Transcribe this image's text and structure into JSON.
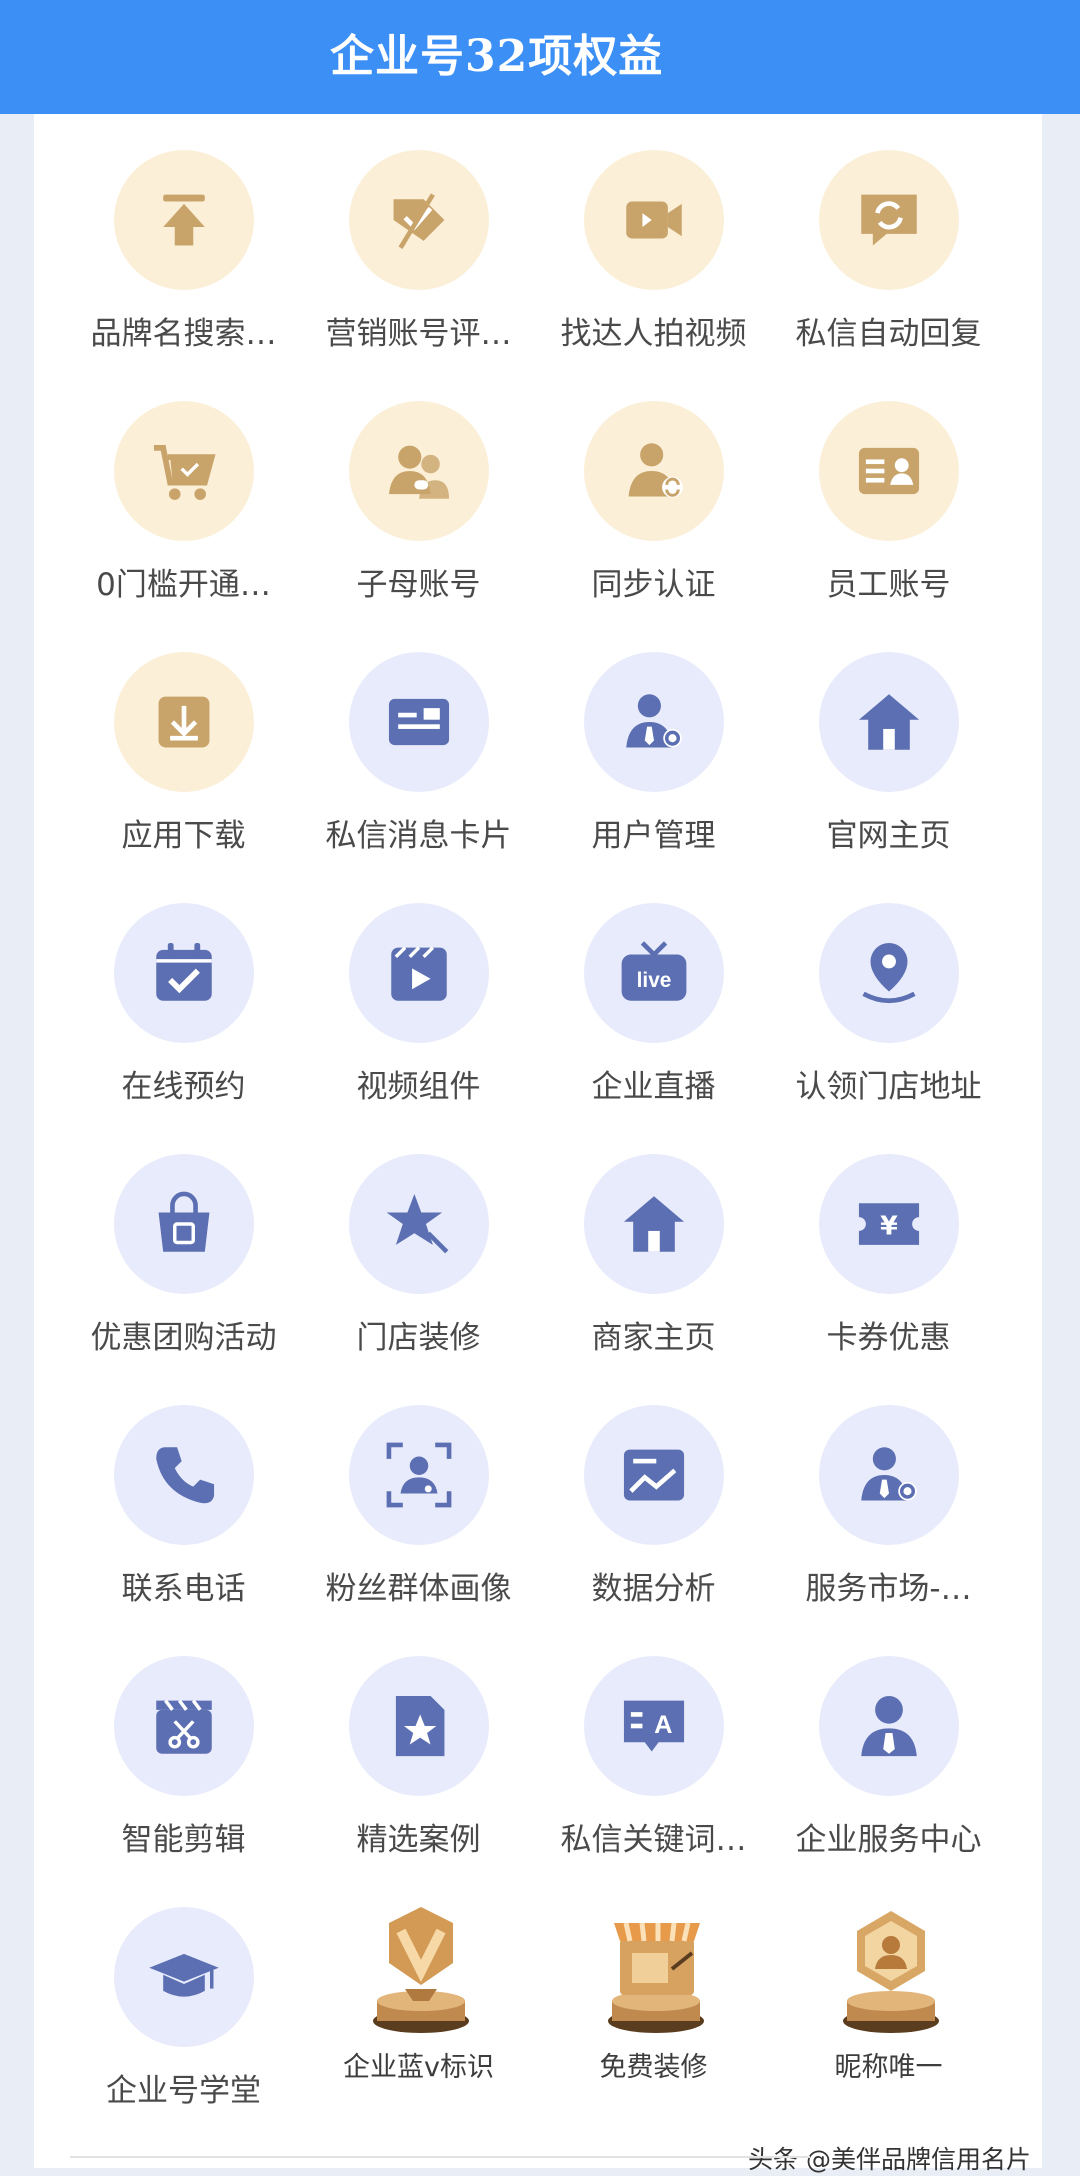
{
  "header": {
    "title": "企业号32项权益"
  },
  "colors": {
    "header_bg": "#3b8ff5",
    "gold_bg": "#fbefd7",
    "gold_icon": "#c9a46a",
    "blue_bg": "#e8ebfb",
    "blue_icon": "#5b6fb2"
  },
  "features": [
    {
      "label": "品牌名搜索…",
      "icon": "arrow-up-icon",
      "style": "gold"
    },
    {
      "label": "营销账号评…",
      "icon": "tag-check-icon",
      "style": "gold"
    },
    {
      "label": "找达人拍视频",
      "icon": "video-camera-icon",
      "style": "gold"
    },
    {
      "label": "私信自动回复",
      "icon": "chat-refresh-icon",
      "style": "gold"
    },
    {
      "label": "0门槛开通…",
      "icon": "cart-check-icon",
      "style": "gold"
    },
    {
      "label": "子母账号",
      "icon": "two-users-icon",
      "style": "gold"
    },
    {
      "label": "同步认证",
      "icon": "user-sync-icon",
      "style": "gold"
    },
    {
      "label": "员工账号",
      "icon": "id-card-icon",
      "style": "gold"
    },
    {
      "label": "应用下载",
      "icon": "download-icon",
      "style": "gold"
    },
    {
      "label": "私信消息卡片",
      "icon": "message-card-icon",
      "style": "blue"
    },
    {
      "label": "用户管理",
      "icon": "user-gear-icon",
      "style": "blue"
    },
    {
      "label": "官网主页",
      "icon": "home-icon",
      "style": "blue"
    },
    {
      "label": "在线预约",
      "icon": "calendar-check-icon",
      "style": "blue"
    },
    {
      "label": "视频组件",
      "icon": "video-play-icon",
      "style": "blue"
    },
    {
      "label": "企业直播",
      "icon": "live-tv-icon",
      "style": "blue"
    },
    {
      "label": "认领门店地址",
      "icon": "location-pin-icon",
      "style": "blue"
    },
    {
      "label": "优惠团购活动",
      "icon": "shopping-bag-icon",
      "style": "blue"
    },
    {
      "label": "门店装修",
      "icon": "star-wand-icon",
      "style": "blue"
    },
    {
      "label": "商家主页",
      "icon": "home-icon",
      "style": "blue"
    },
    {
      "label": "卡券优惠",
      "icon": "coupon-icon",
      "style": "blue"
    },
    {
      "label": "联系电话",
      "icon": "phone-icon",
      "style": "blue"
    },
    {
      "label": "粉丝群体画像",
      "icon": "user-scan-icon",
      "style": "blue"
    },
    {
      "label": "数据分析",
      "icon": "chart-window-icon",
      "style": "blue"
    },
    {
      "label": "服务市场-…",
      "icon": "user-gear-icon",
      "style": "blue"
    },
    {
      "label": "智能剪辑",
      "icon": "clapper-scissors-icon",
      "style": "blue"
    },
    {
      "label": "精选案例",
      "icon": "document-star-icon",
      "style": "blue"
    },
    {
      "label": "私信关键词…",
      "icon": "chat-a-icon",
      "style": "blue"
    },
    {
      "label": "企业服务中心",
      "icon": "business-user-icon",
      "style": "blue"
    },
    {
      "label": "企业号学堂",
      "icon": "graduation-cap-icon",
      "style": "blue"
    }
  ],
  "badges": [
    {
      "label": "企业蓝v标识",
      "icon": "blue-v-badge-icon"
    },
    {
      "label": "免费装修",
      "icon": "storefront-badge-icon"
    },
    {
      "label": "昵称唯一",
      "icon": "user-badge-icon"
    }
  ],
  "watermark": "头条 @美伴品牌信用名片"
}
